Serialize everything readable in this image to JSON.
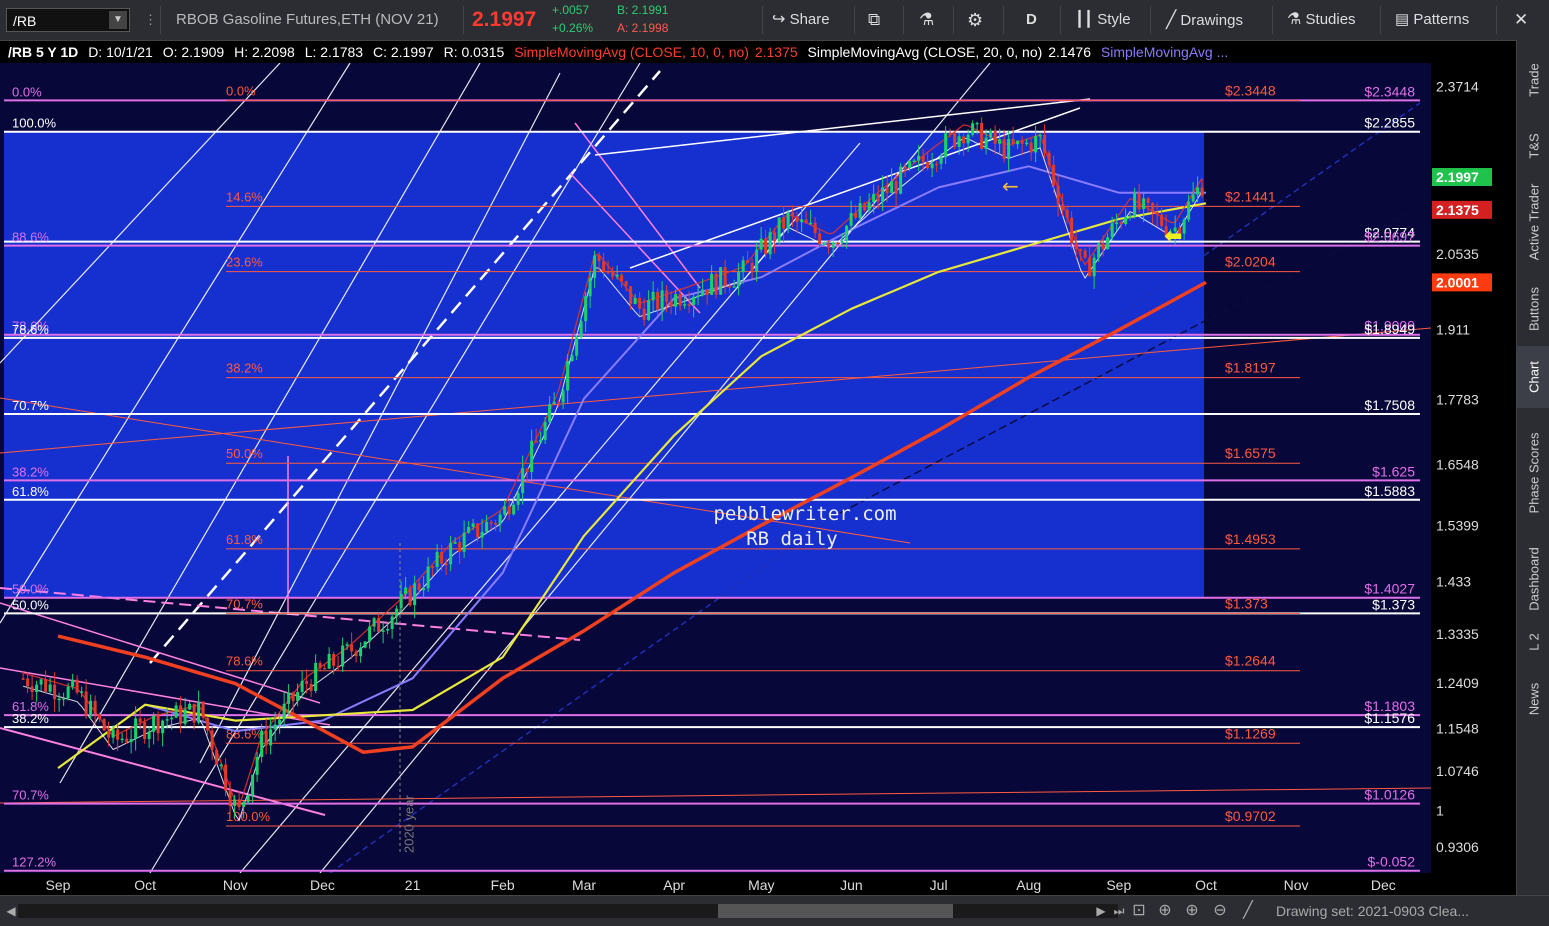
{
  "toolbar": {
    "symbol": "/RB",
    "title": "RBOB Gasoline Futures,ETH (NOV 21)",
    "last": "2.1997",
    "change": "+.0057",
    "change_pct": "+0.26%",
    "bid": "B: 2.1991",
    "ask": "A: 2.1998",
    "share": "Share",
    "period": "D",
    "style": "Style",
    "drawings": "Drawings",
    "studies": "Studies",
    "patterns": "Patterns"
  },
  "info": {
    "symbol": "/RB 5 Y 1D",
    "date": "D: 10/1/21",
    "open": "O: 2.1909",
    "high": "H: 2.2098",
    "low": "L: 2.1783",
    "close": "C: 2.1997",
    "range": "R: 0.0315",
    "sma10": "SimpleMovingAvg (CLOSE, 10, 0, no)",
    "sma10_val": "2.1375",
    "sma20": "SimpleMovingAvg (CLOSE, 20, 0, no)",
    "sma20_val": "2.1476",
    "sma_more": "SimpleMovingAvg ..."
  },
  "colors": {
    "background": "#07073a",
    "box": "#1733d8",
    "up": "#19d26a",
    "down": "#e23a2a",
    "fib_red": "#ff5a3c",
    "fib_magenta": "#e070e8",
    "fib_white": "#ffffff",
    "sma10": "#e8322a",
    "sma20": "#ffffff",
    "sma50": "#8a7cff",
    "sma100": "#e8e83a",
    "sma200": "#f04020"
  },
  "chart_data": {
    "type": "candlestick",
    "ylim": [
      0.8812,
      2.4157
    ],
    "y_ticks": [
      "2.3714",
      "2.0535",
      "1.911",
      "1.7783",
      "1.6548",
      "1.5399",
      "1.433",
      "1.3335",
      "1.2409",
      "1.1548",
      "1.0746",
      "1",
      "0.9306"
    ],
    "x_labels": [
      {
        "label": "Sep",
        "date": "2020-09-01"
      },
      {
        "label": "Oct",
        "date": "2020-10-01"
      },
      {
        "label": "Nov",
        "date": "2020-11-01"
      },
      {
        "label": "Dec",
        "date": "2020-12-01"
      },
      {
        "label": "21",
        "date": "2021-01-01"
      },
      {
        "label": "Feb",
        "date": "2021-02-01"
      },
      {
        "label": "Mar",
        "date": "2021-03-01"
      },
      {
        "label": "Apr",
        "date": "2021-04-01"
      },
      {
        "label": "May",
        "date": "2021-05-01"
      },
      {
        "label": "Jun",
        "date": "2021-06-01"
      },
      {
        "label": "Jul",
        "date": "2021-07-01"
      },
      {
        "label": "Aug",
        "date": "2021-08-01"
      },
      {
        "label": "Sep",
        "date": "2021-09-01"
      },
      {
        "label": "Oct",
        "date": "2021-10-01"
      },
      {
        "label": "Nov",
        "date": "2021-11-01"
      },
      {
        "label": "Dec",
        "date": "2021-12-01"
      }
    ],
    "year_marker": {
      "label": "2020 year",
      "date": "2020-12-31"
    },
    "price_path": [
      [
        "2020-08-20",
        1.25
      ],
      [
        "2020-09-08",
        1.22
      ],
      [
        "2020-09-20",
        1.13
      ],
      [
        "2020-10-05",
        1.17
      ],
      [
        "2020-10-20",
        1.19
      ],
      [
        "2020-11-02",
        0.99
      ],
      [
        "2020-11-10",
        1.13
      ],
      [
        "2020-11-25",
        1.24
      ],
      [
        "2020-12-10",
        1.3
      ],
      [
        "2020-12-28",
        1.39
      ],
      [
        "2021-01-15",
        1.5
      ],
      [
        "2021-02-01",
        1.56
      ],
      [
        "2021-02-20",
        1.78
      ],
      [
        "2021-03-05",
        2.05
      ],
      [
        "2021-03-20",
        1.95
      ],
      [
        "2021-04-05",
        1.98
      ],
      [
        "2021-04-25",
        2.02
      ],
      [
        "2021-05-10",
        2.12
      ],
      [
        "2021-05-25",
        2.08
      ],
      [
        "2021-06-10",
        2.16
      ],
      [
        "2021-06-28",
        2.24
      ],
      [
        "2021-07-10",
        2.29
      ],
      [
        "2021-07-25",
        2.25
      ],
      [
        "2021-08-05",
        2.27
      ],
      [
        "2021-08-20",
        2.02
      ],
      [
        "2021-09-05",
        2.15
      ],
      [
        "2021-09-20",
        2.1
      ],
      [
        "2021-10-01",
        2.1997
      ]
    ],
    "sma200_path": [
      [
        "2020-09-01",
        1.33
      ],
      [
        "2020-10-01",
        1.29
      ],
      [
        "2020-11-01",
        1.24
      ],
      [
        "2020-11-25",
        1.17
      ],
      [
        "2020-12-15",
        1.11
      ],
      [
        "2021-01-01",
        1.12
      ],
      [
        "2021-02-01",
        1.25
      ],
      [
        "2021-03-01",
        1.34
      ],
      [
        "2021-04-01",
        1.45
      ],
      [
        "2021-05-01",
        1.54
      ],
      [
        "2021-06-01",
        1.63
      ],
      [
        "2021-07-01",
        1.72
      ],
      [
        "2021-08-01",
        1.82
      ],
      [
        "2021-09-01",
        1.91
      ],
      [
        "2021-10-01",
        2.0001
      ]
    ],
    "sma100_path": [
      [
        "2020-09-01",
        1.08
      ],
      [
        "2020-10-01",
        1.2
      ],
      [
        "2020-11-01",
        1.17
      ],
      [
        "2020-12-01",
        1.18
      ],
      [
        "2021-01-01",
        1.19
      ],
      [
        "2021-02-01",
        1.29
      ],
      [
        "2021-03-01",
        1.52
      ],
      [
        "2021-04-01",
        1.71
      ],
      [
        "2021-05-01",
        1.86
      ],
      [
        "2021-06-01",
        1.95
      ],
      [
        "2021-07-01",
        2.02
      ],
      [
        "2021-08-01",
        2.07
      ],
      [
        "2021-09-01",
        2.12
      ],
      [
        "2021-10-01",
        2.15
      ]
    ],
    "sma50_path": [
      [
        "2020-10-01",
        1.2
      ],
      [
        "2020-11-01",
        1.15
      ],
      [
        "2020-12-01",
        1.17
      ],
      [
        "2021-01-01",
        1.25
      ],
      [
        "2021-02-01",
        1.45
      ],
      [
        "2021-03-01",
        1.78
      ],
      [
        "2021-04-01",
        1.97
      ],
      [
        "2021-05-01",
        2.01
      ],
      [
        "2021-06-01",
        2.1
      ],
      [
        "2021-07-01",
        2.18
      ],
      [
        "2021-08-01",
        2.22
      ],
      [
        "2021-09-01",
        2.17
      ],
      [
        "2021-10-01",
        2.17
      ]
    ],
    "levels": [
      {
        "left_label": "0.0%",
        "right_label": "$2.3448",
        "value": 2.3448,
        "color": "magenta"
      },
      {
        "left_label": "100.0%",
        "right_label": "$2.2855",
        "value": 2.2855,
        "color": "white"
      },
      {
        "left_label": "",
        "right_label": "$2.0774",
        "value": 2.0774,
        "color": "white"
      },
      {
        "left_label": "88.6%",
        "right_label": "$2.0697",
        "value": 2.0697,
        "color": "magenta"
      },
      {
        "left_label": "78.6%",
        "right_label": "$1.9009",
        "value": 1.9009,
        "color": "magenta"
      },
      {
        "left_label": "78.6%",
        "right_label": "$1.8949",
        "value": 1.8949,
        "color": "white"
      },
      {
        "left_label": "70.7%",
        "right_label": "$1.7508",
        "value": 1.7508,
        "color": "white"
      },
      {
        "left_label": "38.2%",
        "right_label": "$1.625",
        "value": 1.625,
        "color": "magenta"
      },
      {
        "left_label": "61.8%",
        "right_label": "$1.5883",
        "value": 1.5883,
        "color": "white"
      },
      {
        "left_label": "50.0%",
        "right_label": "$1.4027",
        "value": 1.4027,
        "color": "magenta"
      },
      {
        "left_label": "50.0%",
        "right_label": "$1.373",
        "value": 1.373,
        "color": "white"
      },
      {
        "left_label": "61.8%",
        "right_label": "$1.1803",
        "value": 1.1803,
        "color": "magenta"
      },
      {
        "left_label": "38.2%",
        "right_label": "$1.1576",
        "value": 1.1576,
        "color": "white"
      },
      {
        "left_label": "70.7%",
        "right_label": "$1.0126",
        "value": 1.0126,
        "color": "magenta"
      },
      {
        "left_label": "127.2%",
        "right_label": "$-0.052",
        "value": 0.8855,
        "color": "magenta"
      }
    ],
    "fib_red": [
      {
        "pct": "0.0%",
        "price": "$2.3448",
        "value": 2.3448
      },
      {
        "pct": "14.6%",
        "price": "$2.1441",
        "value": 2.1441
      },
      {
        "pct": "23.6%",
        "price": "$2.0204",
        "value": 2.0204
      },
      {
        "pct": "38.2%",
        "price": "$1.8197",
        "value": 1.8197
      },
      {
        "pct": "50.0%",
        "price": "$1.6575",
        "value": 1.6575
      },
      {
        "pct": "61.8%",
        "price": "$1.4953",
        "value": 1.4953
      },
      {
        "pct": "70.7%",
        "price": "$1.373",
        "value": 1.373
      },
      {
        "pct": "78.6%",
        "price": "$1.2644",
        "value": 1.2644
      },
      {
        "pct": "88.6%",
        "price": "$1.1269",
        "value": 1.1269
      },
      {
        "pct": "100.0%",
        "price": "$0.9702",
        "value": 0.9702
      }
    ],
    "price_tags": [
      {
        "label": "2.1997",
        "value": 2.1997,
        "color": "#1fc24a"
      },
      {
        "label": "2.1375",
        "value": 2.1375,
        "color": "#d42020"
      },
      {
        "label": "2.0001",
        "value": 2.0001,
        "color": "#ff3a10"
      }
    ],
    "watermark": [
      "pebblewriter.com",
      "RB daily"
    ]
  },
  "right_tabs": [
    "Trade",
    "T&S",
    "Active Trader",
    "Buttons",
    "Chart",
    "Phase Scores",
    "Dashboard",
    "L 2",
    "News"
  ],
  "bottom": {
    "drawing_set": "Drawing set: 2021-0903 Clea..."
  }
}
